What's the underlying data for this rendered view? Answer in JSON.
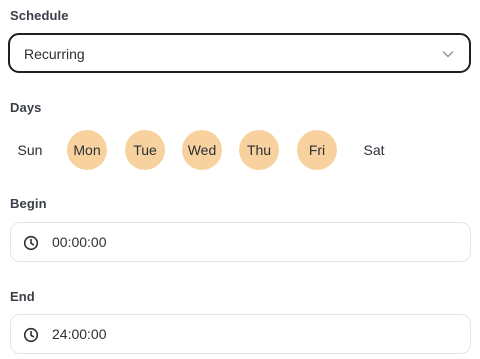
{
  "schedule": {
    "label": "Schedule",
    "value": "Recurring",
    "chevron_icon": "chevron-down-icon"
  },
  "days": {
    "label": "Days",
    "items": [
      {
        "label": "Sun",
        "selected": false
      },
      {
        "label": "Mon",
        "selected": true
      },
      {
        "label": "Tue",
        "selected": true
      },
      {
        "label": "Wed",
        "selected": true
      },
      {
        "label": "Thu",
        "selected": true
      },
      {
        "label": "Fri",
        "selected": true
      },
      {
        "label": "Sat",
        "selected": false
      }
    ],
    "selected_color": "#f8d29e"
  },
  "begin": {
    "label": "Begin",
    "value": "00:00:00",
    "icon": "clock-icon"
  },
  "end": {
    "label": "End",
    "value": "24:00:00",
    "icon": "clock-icon"
  }
}
